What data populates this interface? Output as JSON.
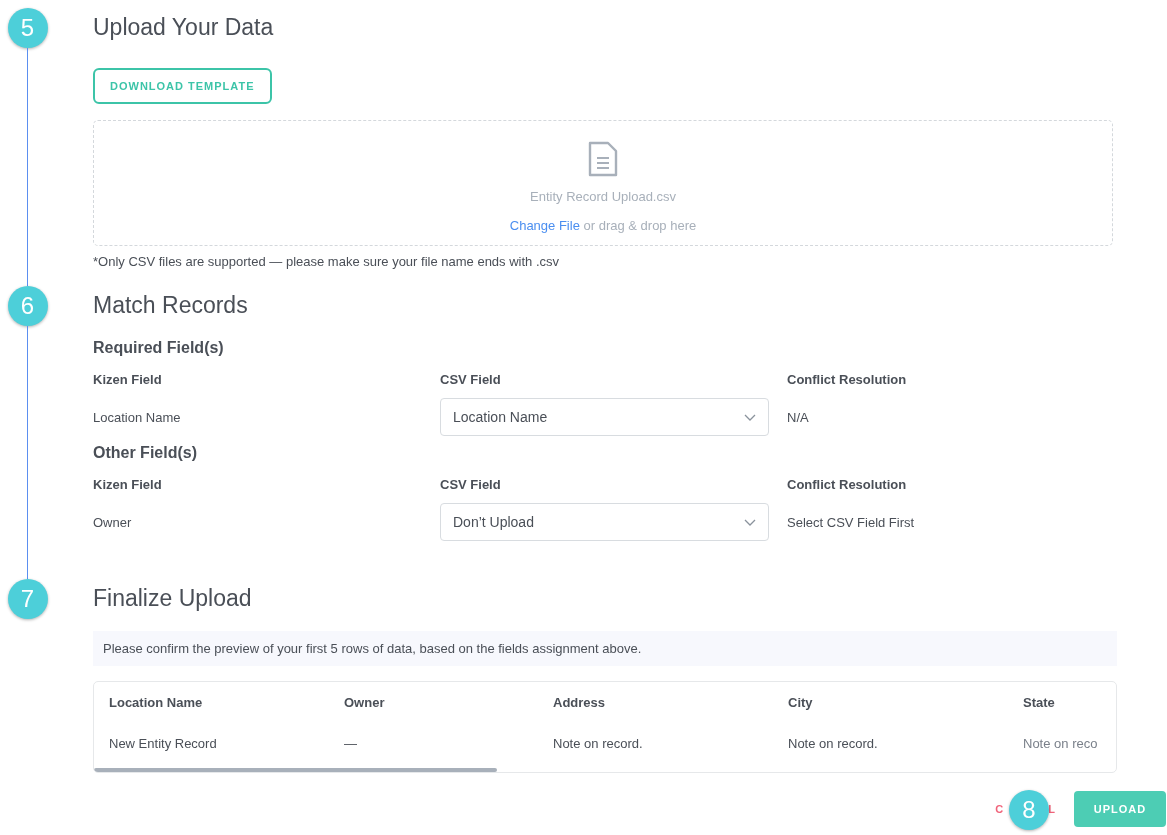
{
  "steps": [
    {
      "number": "5",
      "title": "Upload Your Data",
      "kind": "upload",
      "download_button": "DOWNLOAD TEMPLATE",
      "file_name": "Entity Record Upload.csv",
      "change_link": "Change File",
      "drop_hint": "or drag & drop here",
      "note": "*Only CSV files are supported — please make sure your file name ends with .csv"
    },
    {
      "number": "6",
      "title": "Match Records",
      "kind": "match",
      "groups": [
        {
          "title": "Required Field(s)",
          "columns": [
            "Kizen Field",
            "CSV Field",
            "Conflict Resolution"
          ],
          "rows": [
            {
              "field": "Location Name",
              "csv_value": "Location Name",
              "resolution": "N/A"
            }
          ]
        },
        {
          "title": "Other Field(s)",
          "columns": [
            "Kizen Field",
            "CSV Field",
            "Conflict Resolution"
          ],
          "rows": [
            {
              "field": "Owner",
              "csv_value": "Don’t Upload",
              "resolution": "Select CSV Field First"
            }
          ]
        }
      ]
    },
    {
      "number": "7",
      "title": "Finalize Upload",
      "kind": "preview",
      "info": "Please confirm the preview of your first 5 rows of data, based on the fields assignment above.",
      "columns": [
        "Location Name",
        "Owner",
        "Address",
        "City",
        "State"
      ],
      "rows": [
        [
          "New Entity Record",
          "—",
          "Note on record.",
          "Note on record.",
          "Note on reco"
        ]
      ]
    }
  ],
  "footer": {
    "cancel_start": "C",
    "cancel_end": "L",
    "badge": "8",
    "upload_button": "UPLOAD"
  }
}
